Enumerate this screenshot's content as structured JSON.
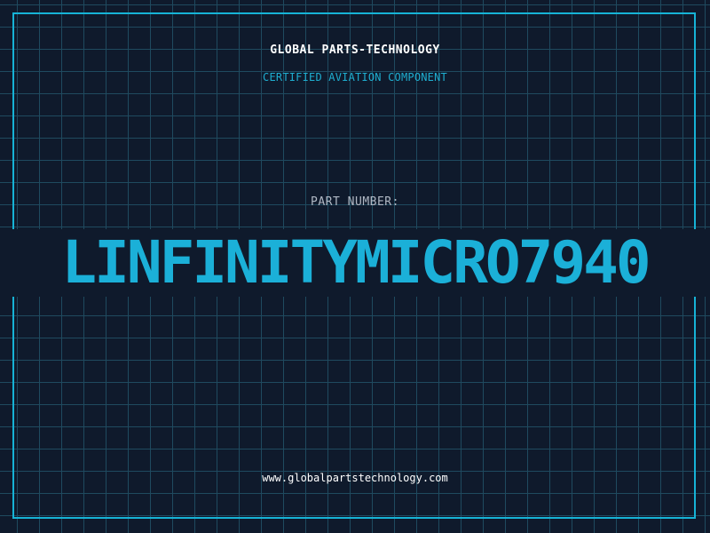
{
  "header": {
    "company": "GLOBAL PARTS-TECHNOLOGY",
    "tagline": "CERTIFIED AVIATION COMPONENT"
  },
  "part": {
    "label": "PART NUMBER:",
    "number": "LINFINITYMICRO7940"
  },
  "footer": {
    "website": "www.globalpartstechnology.com"
  },
  "colors": {
    "background": "#0f1a2c",
    "grid": "#1f4a5f",
    "accent": "#16b3d6",
    "text": "#ffffff",
    "label": "#b0b8c4"
  }
}
